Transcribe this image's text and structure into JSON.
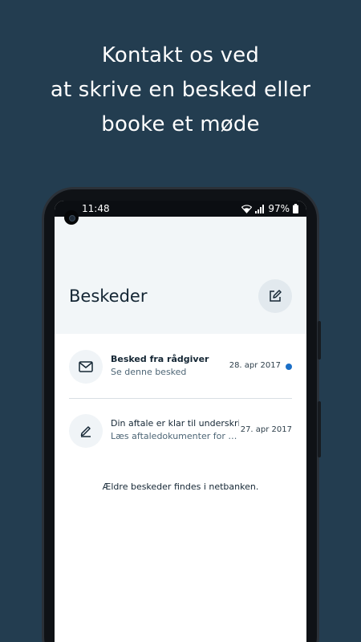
{
  "promo": {
    "line1": "Kontakt os ved",
    "line2": "at skrive en besked eller",
    "line3": "booke et møde"
  },
  "status_bar": {
    "time": "11:48",
    "battery": "97%",
    "icons": [
      "wifi-icon",
      "signal-icon",
      "battery-icon"
    ]
  },
  "header": {
    "title": "Beskeder",
    "compose_icon": "compose-icon"
  },
  "messages": [
    {
      "icon": "envelope-icon",
      "title": "Besked fra rådgiver",
      "subtitle": "Se denne besked",
      "date": "28. apr 2017",
      "unread": true
    },
    {
      "icon": "pen-icon",
      "title": "Din aftale er klar til underskrift",
      "subtitle": "Læs aftaledokumenter for at underskrive",
      "date": "27. apr 2017",
      "unread": false
    }
  ],
  "footer_note": "Ældre beskeder findes i netbanken.",
  "colors": {
    "background": "#233d50",
    "header_bg": "#f2f6f8",
    "unread_dot": "#1b6fc7",
    "text_dark": "#142634"
  }
}
